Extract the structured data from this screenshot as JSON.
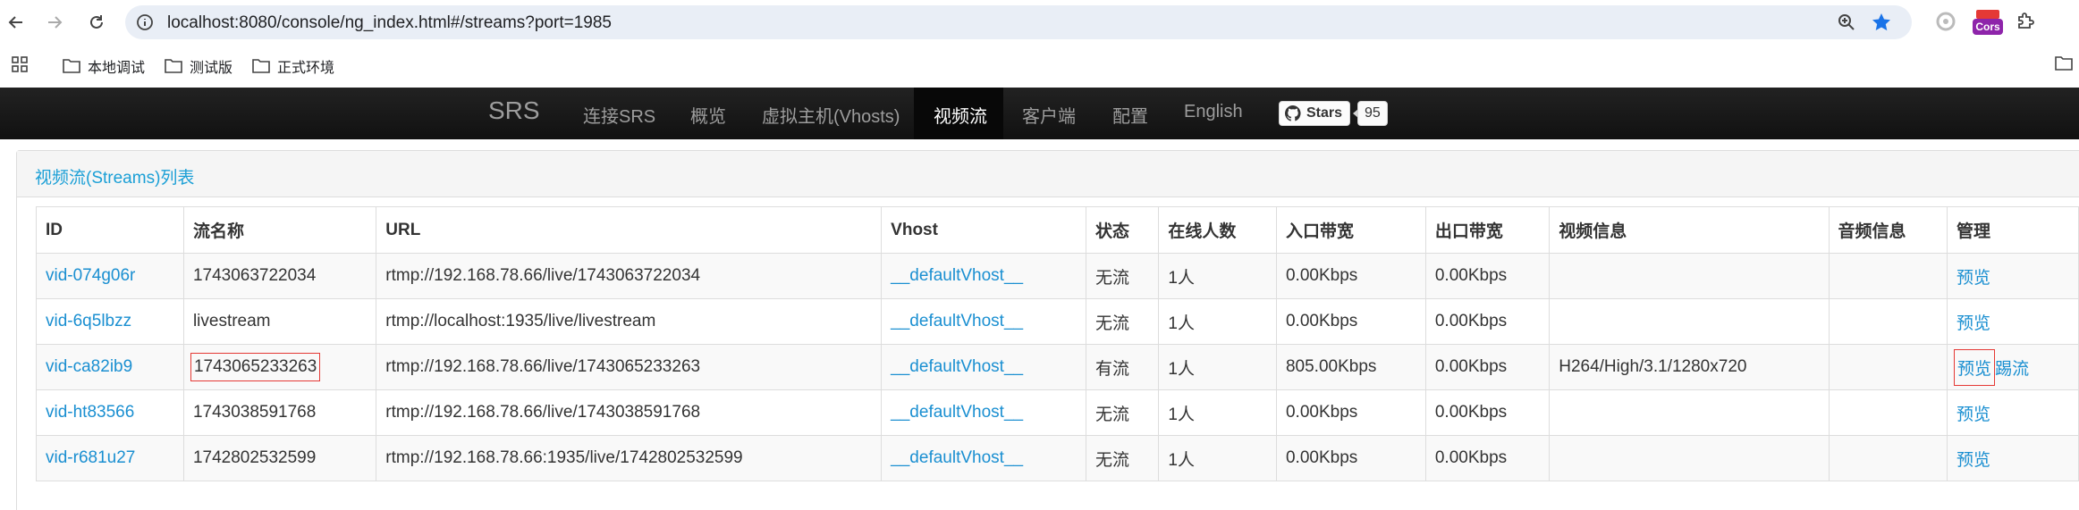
{
  "browser": {
    "url": "localhost:8080/console/ng_index.html#/streams?port=1985",
    "bookmarks": [
      "本地调试",
      "测试版",
      "正式环境"
    ],
    "cors_label": "Cors"
  },
  "navbar": {
    "brand": "SRS",
    "items": [
      "连接SRS",
      "概览",
      "虚拟主机(Vhosts)",
      "视频流",
      "客户端",
      "配置",
      "English"
    ],
    "active_item": "视频流",
    "github_label": "Stars",
    "github_count": "95"
  },
  "panel": {
    "title": "视频流(Streams)列表"
  },
  "table": {
    "headers": [
      "ID",
      "流名称",
      "URL",
      "Vhost",
      "状态",
      "在线人数",
      "入口带宽",
      "出口带宽",
      "视频信息",
      "音频信息",
      "管理"
    ],
    "rows": [
      {
        "id": "vid-074g06r",
        "name": "1743063722034",
        "url": "rtmp://192.168.78.66/live/1743063722034",
        "vhost": "__defaultVhost__",
        "status": "无流",
        "clients": "1人",
        "in_bw": "0.00Kbps",
        "out_bw": "0.00Kbps",
        "video": "",
        "audio": "",
        "preview": "预览",
        "kick": ""
      },
      {
        "id": "vid-6q5lbzz",
        "name": "livestream",
        "url": "rtmp://localhost:1935/live/livestream",
        "vhost": "__defaultVhost__",
        "status": "无流",
        "clients": "1人",
        "in_bw": "0.00Kbps",
        "out_bw": "0.00Kbps",
        "video": "",
        "audio": "",
        "preview": "预览",
        "kick": ""
      },
      {
        "id": "vid-ca82ib9",
        "name": "1743065233263",
        "url": "rtmp://192.168.78.66/live/1743065233263",
        "vhost": "__defaultVhost__",
        "status": "有流",
        "clients": "1人",
        "in_bw": "805.00Kbps",
        "out_bw": "0.00Kbps",
        "video": "H264/High/3.1/1280x720",
        "audio": "",
        "preview": "预览",
        "kick": "踢流"
      },
      {
        "id": "vid-ht83566",
        "name": "1743038591768",
        "url": "rtmp://192.168.78.66/live/1743038591768",
        "vhost": "__defaultVhost__",
        "status": "无流",
        "clients": "1人",
        "in_bw": "0.00Kbps",
        "out_bw": "0.00Kbps",
        "video": "",
        "audio": "",
        "preview": "预览",
        "kick": ""
      },
      {
        "id": "vid-r681u27",
        "name": "1742802532599",
        "url": "rtmp://192.168.78.66:1935/live/1742802532599",
        "vhost": "__defaultVhost__",
        "status": "无流",
        "clients": "1人",
        "in_bw": "0.00Kbps",
        "out_bw": "0.00Kbps",
        "video": "",
        "audio": "",
        "preview": "预览",
        "kick": ""
      }
    ]
  },
  "colors": {
    "link": "#1a8fd1",
    "title": "#1a9fd6",
    "navbar": "#222222",
    "highlight_box": "#e53935"
  }
}
